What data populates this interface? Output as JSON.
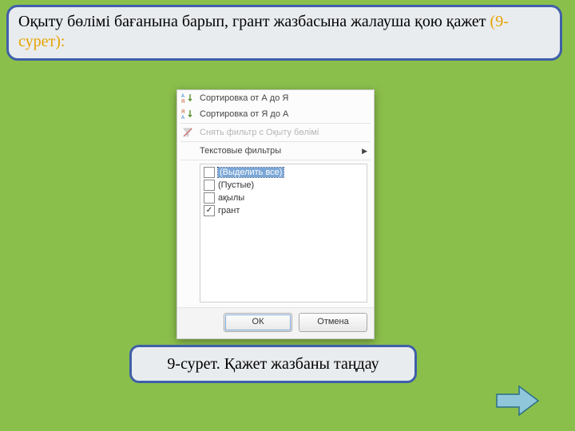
{
  "title": {
    "black": "Оқыту бөлімі бағанына барып, грант жазбасына жалауша қою қажет ",
    "orange": "(9-сурет):"
  },
  "menu": {
    "sort_asc": "Сортировка от А до Я",
    "sort_desc": "Сортировка от Я до А",
    "clear_filter": "Снять фильтр с Оқыту бөлімі",
    "text_filters": "Текстовые фильтры",
    "items": [
      {
        "label": "(Выделить все)",
        "checked": false,
        "selected": true
      },
      {
        "label": "(Пустые)",
        "checked": false,
        "selected": false
      },
      {
        "label": "ақылы",
        "checked": false,
        "selected": false
      },
      {
        "label": "грант",
        "checked": true,
        "selected": false
      }
    ],
    "ok": "ОК",
    "cancel": "Отмена"
  },
  "caption": "9-сурет. Қажет жазбаны таңдау"
}
